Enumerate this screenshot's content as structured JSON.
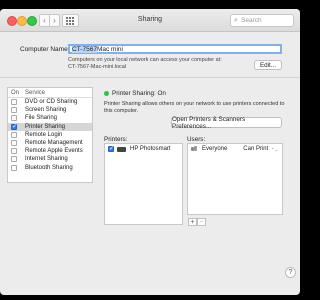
{
  "window": {
    "title": "Sharing"
  },
  "toolbar": {
    "back_glyph": "‹",
    "forward_glyph": "›",
    "search_placeholder": "Search",
    "search_icon": "⌕"
  },
  "computer_name": {
    "label": "Computer Name:",
    "value_selected": "CT-7567",
    "value_rest": " Mac mini",
    "info_line1": "Computers on your local network can access your computer at:",
    "info_line2": "CT-7567-Mac-mini.local",
    "edit_button": "Edit..."
  },
  "services": {
    "header_on": "On",
    "header_service": "Service",
    "items": [
      {
        "label": "DVD or CD Sharing",
        "checked": false,
        "check": ""
      },
      {
        "label": "Screen Sharing",
        "checked": false,
        "check": ""
      },
      {
        "label": "File Sharing",
        "checked": false,
        "check": ""
      },
      {
        "label": "Printer Sharing",
        "checked": true,
        "check": "✓"
      },
      {
        "label": "Remote Login",
        "checked": false,
        "check": ""
      },
      {
        "label": "Remote Management",
        "checked": false,
        "check": ""
      },
      {
        "label": "Remote Apple Events",
        "checked": false,
        "check": ""
      },
      {
        "label": "Internet Sharing",
        "checked": false,
        "check": ""
      },
      {
        "label": "Bluetooth Sharing",
        "checked": false,
        "check": ""
      }
    ]
  },
  "detail": {
    "status": "Printer Sharing: On",
    "description_line1": "Printer Sharing allows others on your network to use printers connected to",
    "description_line2": "this computer.",
    "open_prefs_button": "Open Printers & Scanners Preferences...",
    "printers_label": "Printers:",
    "users_label": "Users:",
    "printer": {
      "name": "HP Photosmart",
      "check": "✓"
    },
    "user": {
      "name": "Everyone",
      "permission": "Can Print",
      "chevron": "⌃⌄"
    },
    "add_glyph": "+",
    "remove_glyph": "−"
  },
  "help": {
    "glyph": "?"
  },
  "colors": {
    "accent": "#2f7cf6",
    "status_on": "#2dc24a",
    "selection": "#b7d5fb"
  }
}
